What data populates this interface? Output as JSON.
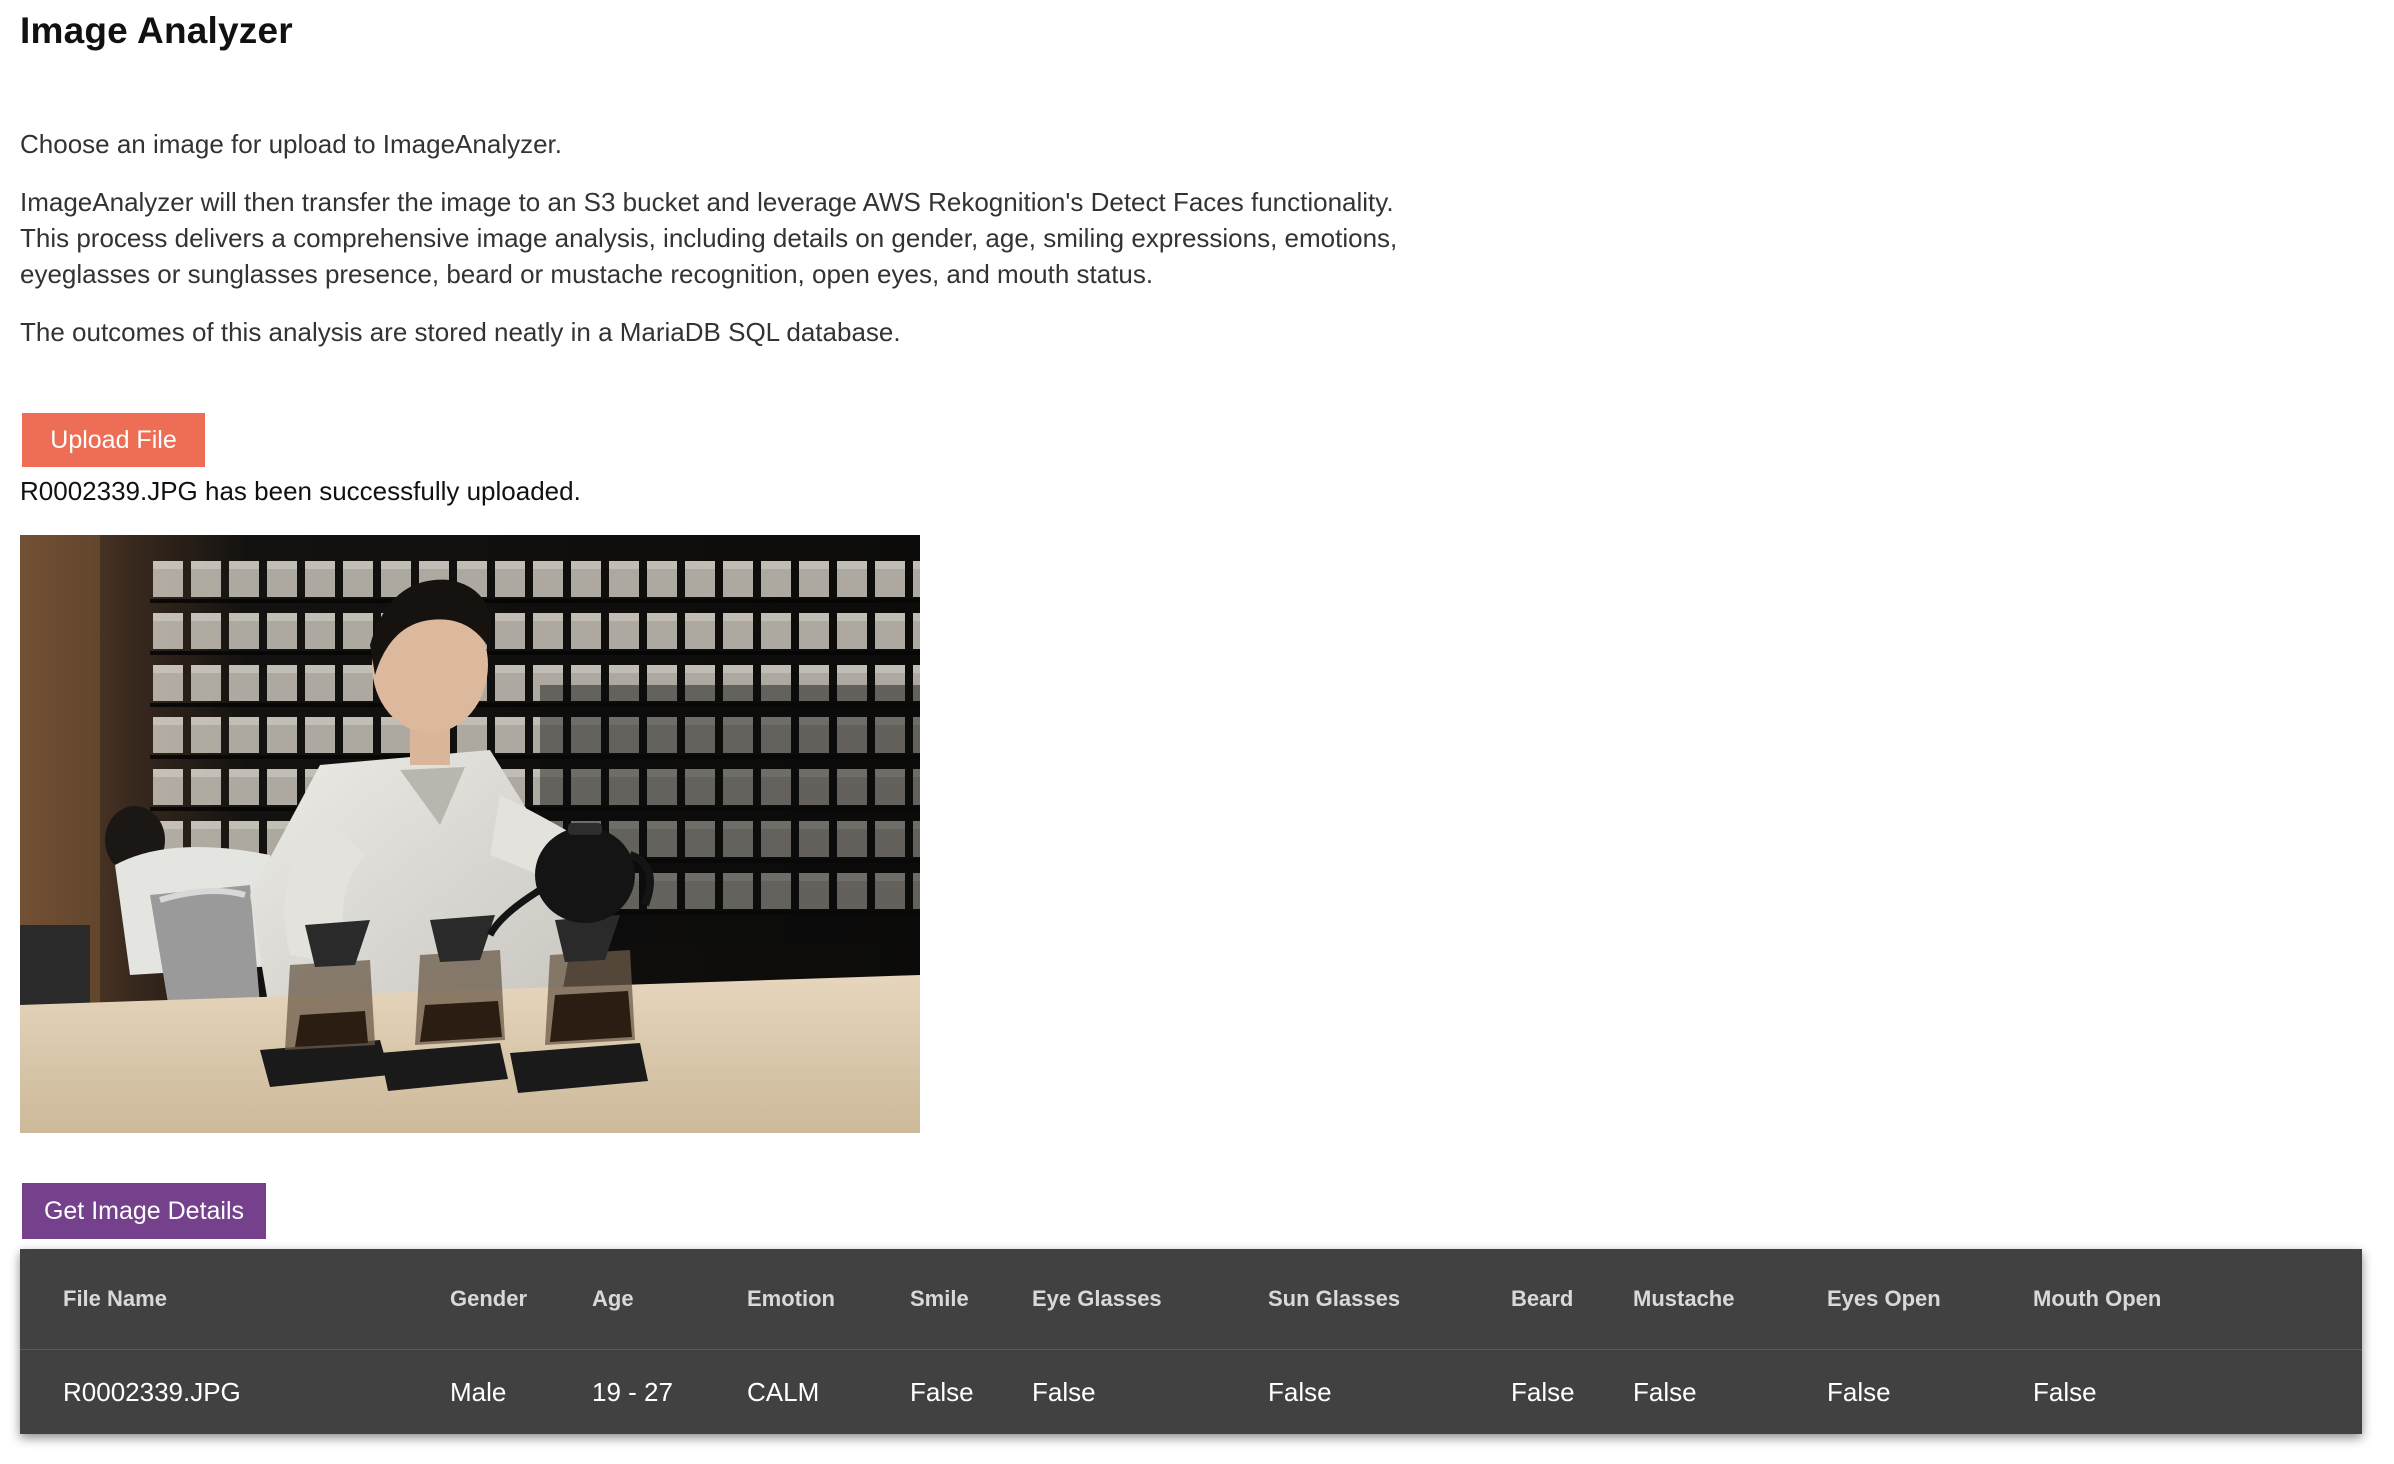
{
  "page": {
    "title": "Image Analyzer"
  },
  "intro": {
    "paragraph_1": "Choose an image for upload to ImageAnalyzer.",
    "paragraph_2": "ImageAnalyzer will then transfer the image to an S3 bucket and leverage AWS Rekognition's Detect Faces functionality. This process delivers a comprehensive image analysis, including details on gender, age, smiling expressions, emotions, eyeglasses or sunglasses presence, beard or mustache recognition, open eyes, and mouth status.",
    "paragraph_3": "The outcomes of this analysis are stored neatly in a MariaDB SQL database."
  },
  "upload": {
    "button_label": "Upload File",
    "button_color": "#ee6e55",
    "status_message": "R0002339.JPG has been successfully uploaded."
  },
  "image_preview": {
    "subject": "barista pouring coffee from black kettle into three pour-over drippers in a cafe with shelves of coffee bags"
  },
  "details": {
    "button_label": "Get Image Details",
    "button_color": "#76418c"
  },
  "results_table": {
    "background_color": "#414141",
    "headers": {
      "file_name": "File Name",
      "gender": "Gender",
      "age": "Age",
      "emotion": "Emotion",
      "smile": "Smile",
      "eye_glasses": "Eye Glasses",
      "sun_glasses": "Sun Glasses",
      "beard": "Beard",
      "mustache": "Mustache",
      "eyes_open": "Eyes Open",
      "mouth_open": "Mouth Open"
    },
    "rows": [
      {
        "file_name": "R0002339.JPG",
        "gender": "Male",
        "age": "19 - 27",
        "emotion": "CALM",
        "smile": "False",
        "eye_glasses": "False",
        "sun_glasses": "False",
        "beard": "False",
        "mustache": "False",
        "eyes_open": "False",
        "mouth_open": "False"
      }
    ]
  }
}
